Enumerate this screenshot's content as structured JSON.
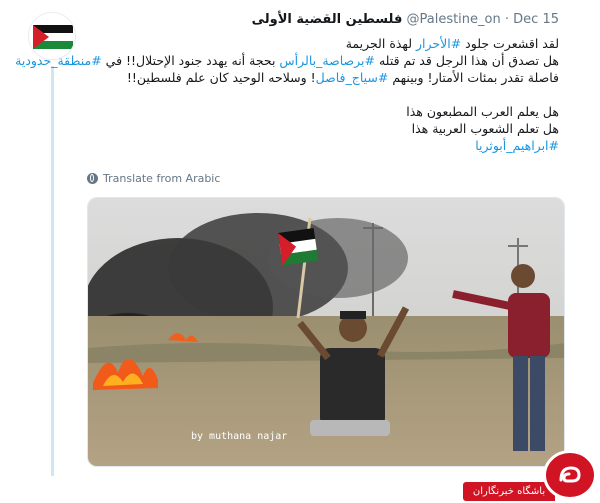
{
  "account": {
    "name": "فلسطين القضية الأولى",
    "handle": "@Palestine_on",
    "separator": "·",
    "date": "Dec 15"
  },
  "tweet": {
    "line1_prefix": "لقد اقشعرت جلود ",
    "line1_tag": "#الأحرار",
    "line1_suffix": " لهذة الجريمة",
    "line2_prefix": "هل تصدق أن هذا الرجل قد تم قتله ",
    "line2_tag": "#برصاصة_بالرأس",
    "line2_mid": " بحجة أنه يهدد جنود الإحتلال!! في ",
    "line2_tag2": "#منطقة_حدودية",
    "line3_prefix": "فاصلة تقدر بمئات الأمتار! وبينهم ",
    "line3_tag": "#سياج_فاصل",
    "line3_suffix": "! وسلاحه الوحيد كان علم فلسطين!!",
    "line4": "هل يعلم العرب المطبعون هذا",
    "line5": "هل تعلم الشعوب العربية هذا",
    "line6_tag": "#ابراهيم_أبوثريا"
  },
  "translate_label": "Translate from Arabic",
  "photo": {
    "credit": "by muthana najar"
  },
  "watermark": {
    "label": "باشگاه خبرنگاران"
  },
  "colors": {
    "link": "#1b95e0",
    "muted": "#657786",
    "badge": "#d01424"
  },
  "icons": [
    "flag-avatar-icon",
    "globe-icon",
    "watermark-logo-icon"
  ]
}
